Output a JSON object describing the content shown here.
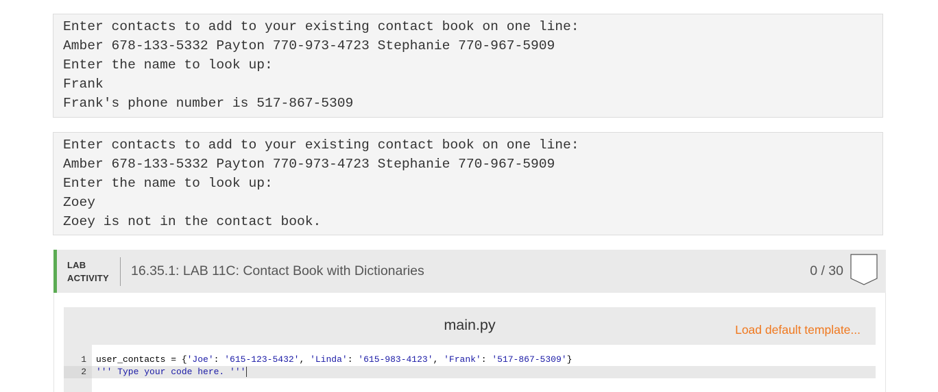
{
  "console_outputs": [
    {
      "lines": [
        "Enter contacts to add to your existing contact book on one line:",
        "Amber 678-133-5332 Payton 770-973-4723 Stephanie 770-967-5909",
        "Enter the name to look up:",
        "Frank",
        "Frank's phone number is 517-867-5309"
      ]
    },
    {
      "lines": [
        "Enter contacts to add to your existing contact book on one line:",
        "Amber 678-133-5332 Payton 770-973-4723 Stephanie 770-967-5909",
        "Enter the name to look up:",
        "Zoey",
        "Zoey is not in the contact book."
      ]
    }
  ],
  "lab": {
    "type_line1": "LAB",
    "type_line2": "ACTIVITY",
    "title": "16.35.1: LAB 11C: Contact Book with Dictionaries",
    "score": "0 / 30",
    "accent_color": "#5bab53"
  },
  "editor": {
    "file_name": "main.py",
    "load_template_label": "Load default template...",
    "load_template_color": "#f0781e",
    "lines": [
      {
        "number": "1",
        "prefix": "user_contacts = {",
        "k1": "'Joe'",
        "sep1": ": ",
        "v1": "'615-123-5432'",
        "c1": ", ",
        "k2": "'Linda'",
        "sep2": ": ",
        "v2": "'615-983-4123'",
        "c2": ", ",
        "k3": "'Frank'",
        "sep3": ": ",
        "v3": "'517-867-5309'",
        "suffix": "}"
      },
      {
        "number": "2",
        "text": "''' Type your code here. '''"
      }
    ]
  }
}
